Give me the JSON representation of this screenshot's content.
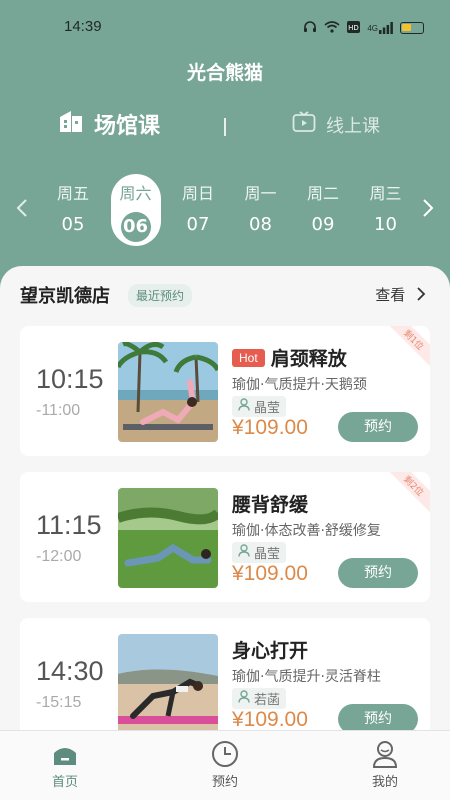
{
  "status_bar": {
    "time": "14:39",
    "network": "4G"
  },
  "app_title": "光合熊猫",
  "mode_tabs": {
    "venue": "场馆课",
    "online": "线上课"
  },
  "dates": [
    {
      "weekday": "周五",
      "day": "05",
      "active": false
    },
    {
      "weekday": "周六",
      "day": "06",
      "active": true
    },
    {
      "weekday": "周日",
      "day": "07",
      "active": false
    },
    {
      "weekday": "周一",
      "day": "08",
      "active": false
    },
    {
      "weekday": "周二",
      "day": "09",
      "active": false
    },
    {
      "weekday": "周三",
      "day": "10",
      "active": false
    }
  ],
  "store": {
    "name": "望京凯德店",
    "badge": "最近预约",
    "view": "查看"
  },
  "classes": [
    {
      "start": "10:15",
      "end": "-11:00",
      "hot": "Hot",
      "title": "肩颈释放",
      "tags": "瑜伽·气质提升·天鹅颈",
      "coach": "晶莹",
      "price": "¥109.00",
      "button": "预约",
      "ribbon": "剩1位"
    },
    {
      "start": "11:15",
      "end": "-12:00",
      "hot": "",
      "title": "腰背舒缓",
      "tags": "瑜伽·体态改善·舒缓修复",
      "coach": "晶莹",
      "price": "¥109.00",
      "button": "预约",
      "ribbon": "剩2位"
    },
    {
      "start": "14:30",
      "end": "-15:15",
      "hot": "",
      "title": "身心打开",
      "tags": "瑜伽·气质提升·灵活脊柱",
      "coach": "若菡",
      "price": "¥109.00",
      "button": "预约",
      "ribbon": ""
    }
  ],
  "tabbar": {
    "home": "首页",
    "booking": "预约",
    "mine": "我的"
  },
  "colors": {
    "brand": "#77a596",
    "price": "#dc8a4a",
    "hot": "#e65c4f"
  }
}
